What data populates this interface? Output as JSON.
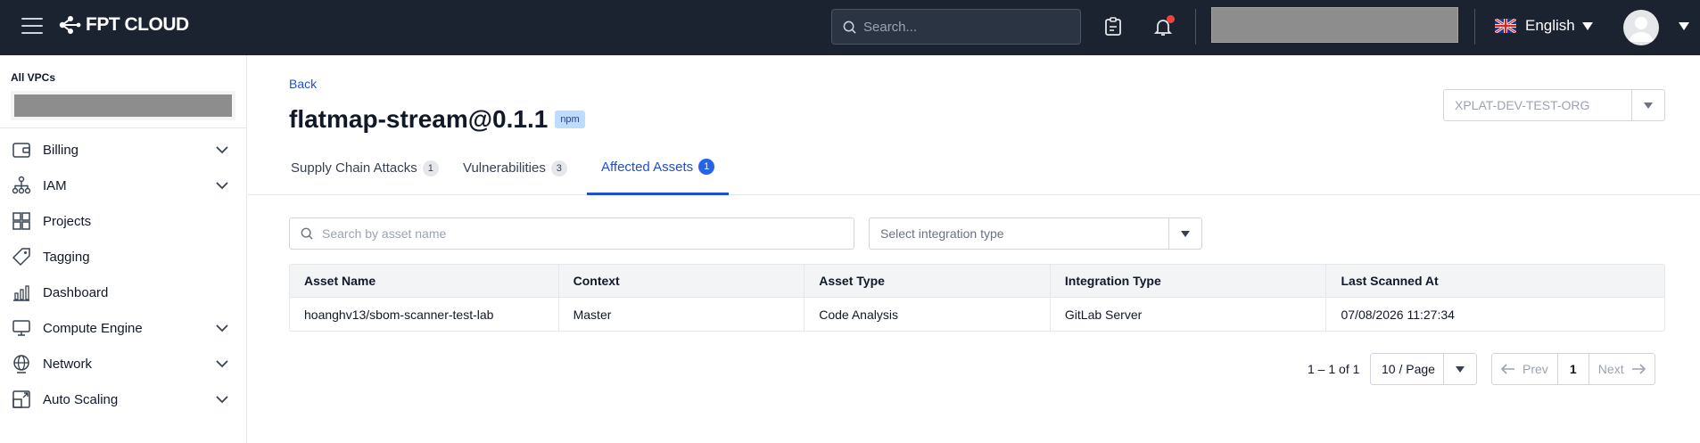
{
  "topbar": {
    "brand": "FPT CLOUD",
    "search_placeholder": "Search...",
    "language": "English"
  },
  "sidebar": {
    "vpc_label": "All VPCs",
    "items": [
      {
        "label": "Billing",
        "icon": "wallet-icon",
        "expandable": true
      },
      {
        "label": "IAM",
        "icon": "hierarchy-icon",
        "expandable": true
      },
      {
        "label": "Projects",
        "icon": "projects-icon",
        "expandable": false
      },
      {
        "label": "Tagging",
        "icon": "tag-icon",
        "expandable": false
      },
      {
        "label": "Dashboard",
        "icon": "dashboard-icon",
        "expandable": false
      },
      {
        "label": "Compute Engine",
        "icon": "monitor-icon",
        "expandable": true
      },
      {
        "label": "Network",
        "icon": "globe-icon",
        "expandable": true
      },
      {
        "label": "Auto Scaling",
        "icon": "scaling-icon",
        "expandable": true
      }
    ]
  },
  "main": {
    "back_label": "Back",
    "title": "flatmap-stream@0.1.1",
    "badge": "npm",
    "org": "XPLAT-DEV-TEST-ORG",
    "tabs": [
      {
        "label": "Supply Chain Attacks",
        "count": "1",
        "active": false
      },
      {
        "label": "Vulnerabilities",
        "count": "3",
        "active": false
      },
      {
        "label": "Affected Assets",
        "count": "1",
        "active": true
      }
    ],
    "asset_search_placeholder": "Search by asset name",
    "integration_placeholder": "Select integration type",
    "table": {
      "headers": [
        "Asset Name",
        "Context",
        "Asset Type",
        "Integration Type",
        "Last Scanned At"
      ],
      "rows": [
        [
          "hoanghv13/sbom-scanner-test-lab",
          "Master",
          "Code Analysis",
          "GitLab Server",
          "07/08/2026 11:27:34"
        ]
      ]
    },
    "pagination": {
      "range": "1 – 1 of 1",
      "per_page": "10 / Page",
      "prev": "Prev",
      "current": "1",
      "next": "Next"
    }
  }
}
